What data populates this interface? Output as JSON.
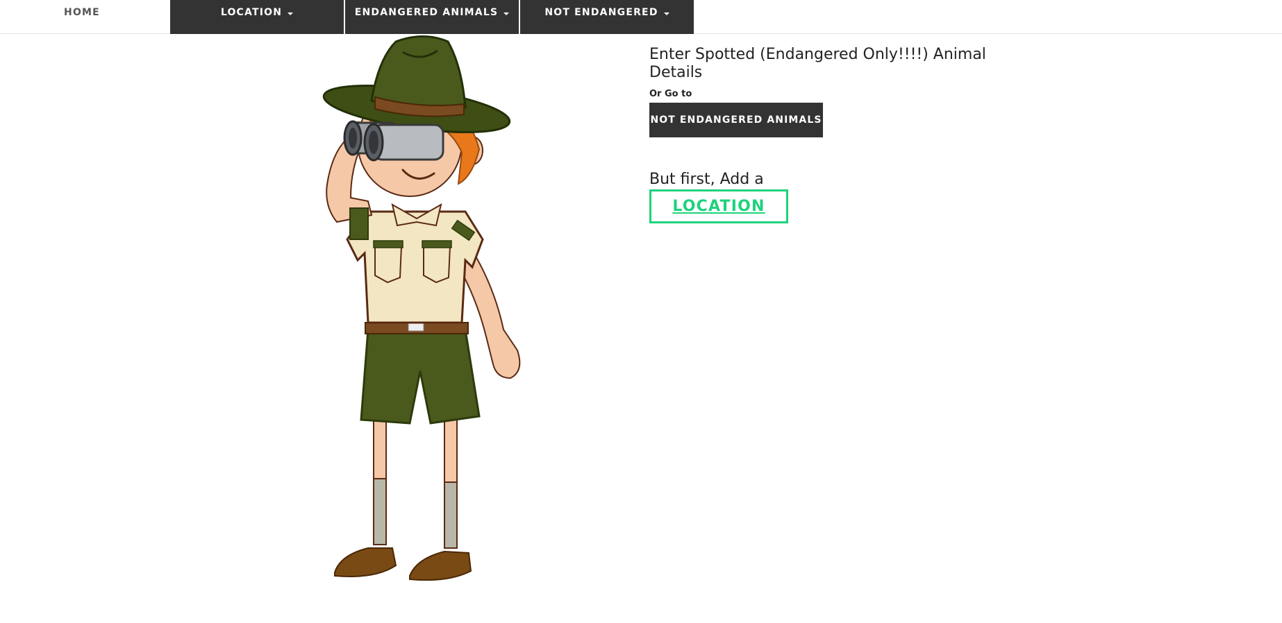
{
  "nav": {
    "home_label": "HOME",
    "location_label": "LOCATION",
    "endangered_label": "ENDANGERED ANIMALS",
    "not_endangered_label": "NOT ENDANGERED"
  },
  "main": {
    "heading": "Enter Spotted (Endangered Only!!!!) Animal Details",
    "or_go_to": "Or Go to",
    "not_endangered_button": "NOT ENDANGERED ANIMALS",
    "add_prompt": "But first, Add a",
    "location_button": "LOCATION"
  },
  "colors": {
    "nav_dark": "#333333",
    "accent_green": "#1ed27c",
    "uniform_green": "#4a5a1c",
    "shirt_cream": "#f3e6c2"
  },
  "illustration": {
    "icon": "park-ranger-with-binoculars-illustration"
  }
}
